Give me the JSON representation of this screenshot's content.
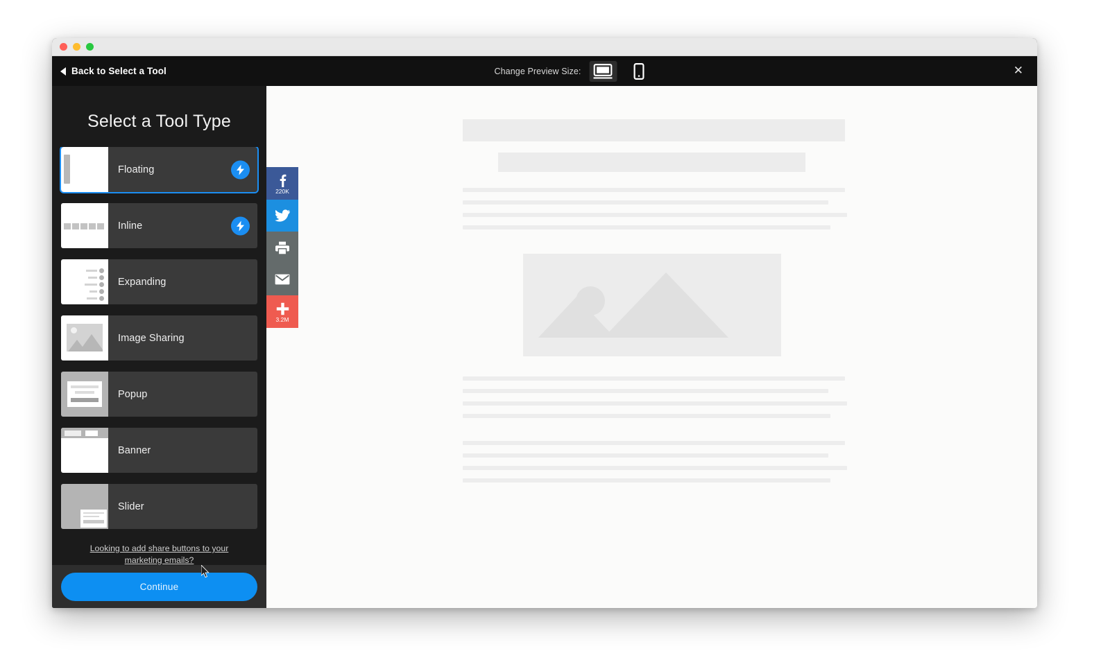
{
  "window": {
    "traffic_lights": [
      "close",
      "minimize",
      "maximize"
    ]
  },
  "toolbar": {
    "back_label": "Back to Select a Tool",
    "preview_size_label": "Change Preview Size:",
    "desktop_icon": "desktop-monitor-icon",
    "mobile_icon": "mobile-phone-icon",
    "active_size": "desktop",
    "close_label": "✕"
  },
  "sidebar": {
    "title": "Select a Tool Type",
    "tools": [
      {
        "label": "Floating",
        "thumb": "floating",
        "badge": "lightning-bolt",
        "selected": true
      },
      {
        "label": "Inline",
        "thumb": "inline",
        "badge": "lightning-bolt",
        "selected": false
      },
      {
        "label": "Expanding",
        "thumb": "expanding",
        "badge": null,
        "selected": false
      },
      {
        "label": "Image Sharing",
        "thumb": "image",
        "badge": null,
        "selected": false
      },
      {
        "label": "Popup",
        "thumb": "popup",
        "badge": null,
        "selected": false
      },
      {
        "label": "Banner",
        "thumb": "banner",
        "badge": null,
        "selected": false
      },
      {
        "label": "Slider",
        "thumb": "slider",
        "badge": null,
        "selected": false
      }
    ],
    "email_link": "Looking to add share buttons to your marketing emails?",
    "continue_label": "Continue"
  },
  "preview": {
    "share_widget": {
      "buttons": [
        {
          "network": "facebook",
          "icon": "facebook-icon",
          "count": "220K",
          "color": "#3b5998"
        },
        {
          "network": "twitter",
          "icon": "twitter-bird-icon",
          "count": "",
          "color": "#1c8fe0"
        },
        {
          "network": "print",
          "icon": "printer-icon",
          "count": "",
          "color": "#646b6b"
        },
        {
          "network": "email",
          "icon": "envelope-icon",
          "count": "",
          "color": "#646b6b"
        },
        {
          "network": "addthis",
          "icon": "plus-icon",
          "count": "3.2M",
          "color": "#ef5b50"
        }
      ]
    },
    "placeholder_image_icon": "image-placeholder-icon"
  },
  "colors": {
    "accent_blue": "#1b8ef2",
    "continue_blue": "#0d8ff2",
    "sidebar_dark": "#1b1b1b",
    "toolbar_dark": "#111111",
    "tool_row": "#3a3a3a",
    "footer": "#2e2e2e"
  }
}
